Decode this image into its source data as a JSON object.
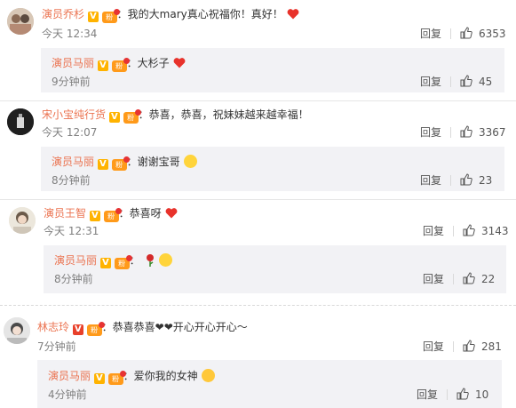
{
  "comments": [
    {
      "name": "演员乔杉",
      "text": "：我的大mary真心祝福你！真好！",
      "time": "今天 12:34",
      "reply": "回复",
      "likes": "6353",
      "sub": {
        "name": "演员马丽",
        "text": "：大杉子",
        "time": "9分钟前",
        "reply": "回复",
        "likes": "45"
      }
    },
    {
      "name": "宋小宝纯行货",
      "text": "：恭喜，恭喜，祝妹妹越来越幸福！",
      "time": "今天 12:07",
      "reply": "回复",
      "likes": "3367",
      "sub": {
        "name": "演员马丽",
        "text": "：谢谢宝哥",
        "time": "8分钟前",
        "reply": "回复",
        "likes": "23"
      }
    },
    {
      "name": "演员王智",
      "text": "：恭喜呀",
      "time": "今天 12:31",
      "reply": "回复",
      "likes": "3143",
      "sub": {
        "name": "演员马丽",
        "text": "：",
        "time": "8分钟前",
        "reply": "回复",
        "likes": "22"
      }
    },
    {
      "name": "林志玲",
      "text": "：恭喜恭喜❤❤开心开心开心～",
      "time": "7分钟前",
      "reply": "回复",
      "likes": "281",
      "sub": {
        "name": "演员马丽",
        "text": "：爱你我的女神",
        "time": "4分钟前",
        "reply": "回复",
        "likes": "10"
      }
    }
  ],
  "badges": {
    "v": "V",
    "fan": "粉"
  },
  "colors": {
    "name": "#eb7350",
    "heart": "#e8322b",
    "sub_bg": "#f2f2f5"
  },
  "icons": [
    "thumb-up-icon",
    "heart-icon",
    "rose-icon",
    "smile-emoji-icon",
    "kiss-emoji-icon",
    "vip-v-icon",
    "fan-badge-icon"
  ]
}
